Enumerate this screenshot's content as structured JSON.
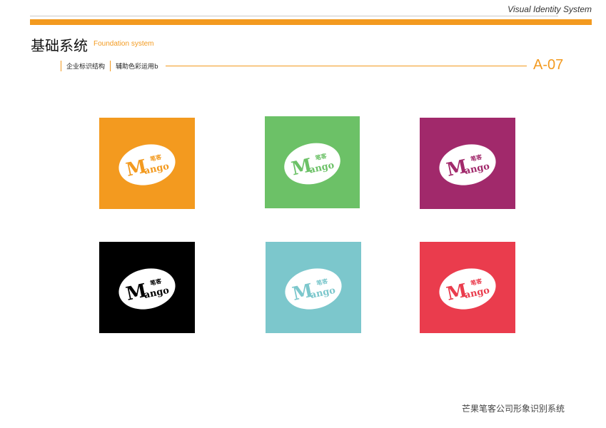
{
  "header": {
    "system_label": "Visual Identity System",
    "title_cn": "基础系统",
    "title_en": "Foundation system",
    "breadcrumbs": [
      "企业标识结构",
      "辅助色彩运用b"
    ],
    "page_number": "A-07"
  },
  "logo": {
    "wordmark": "Mango",
    "cn_mark": "笔客"
  },
  "colors": {
    "accent": "#f39a1f"
  },
  "tiles": [
    {
      "name": "orange",
      "color": "#f39a1f"
    },
    {
      "name": "green",
      "color": "#6cc167"
    },
    {
      "name": "purple",
      "color": "#a1296b"
    },
    {
      "name": "black",
      "color": "#000000"
    },
    {
      "name": "teal",
      "color": "#7cc7cc"
    },
    {
      "name": "red",
      "color": "#ea3c4d"
    }
  ],
  "footer": {
    "company": "芒果笔客公司形象识别系统"
  }
}
